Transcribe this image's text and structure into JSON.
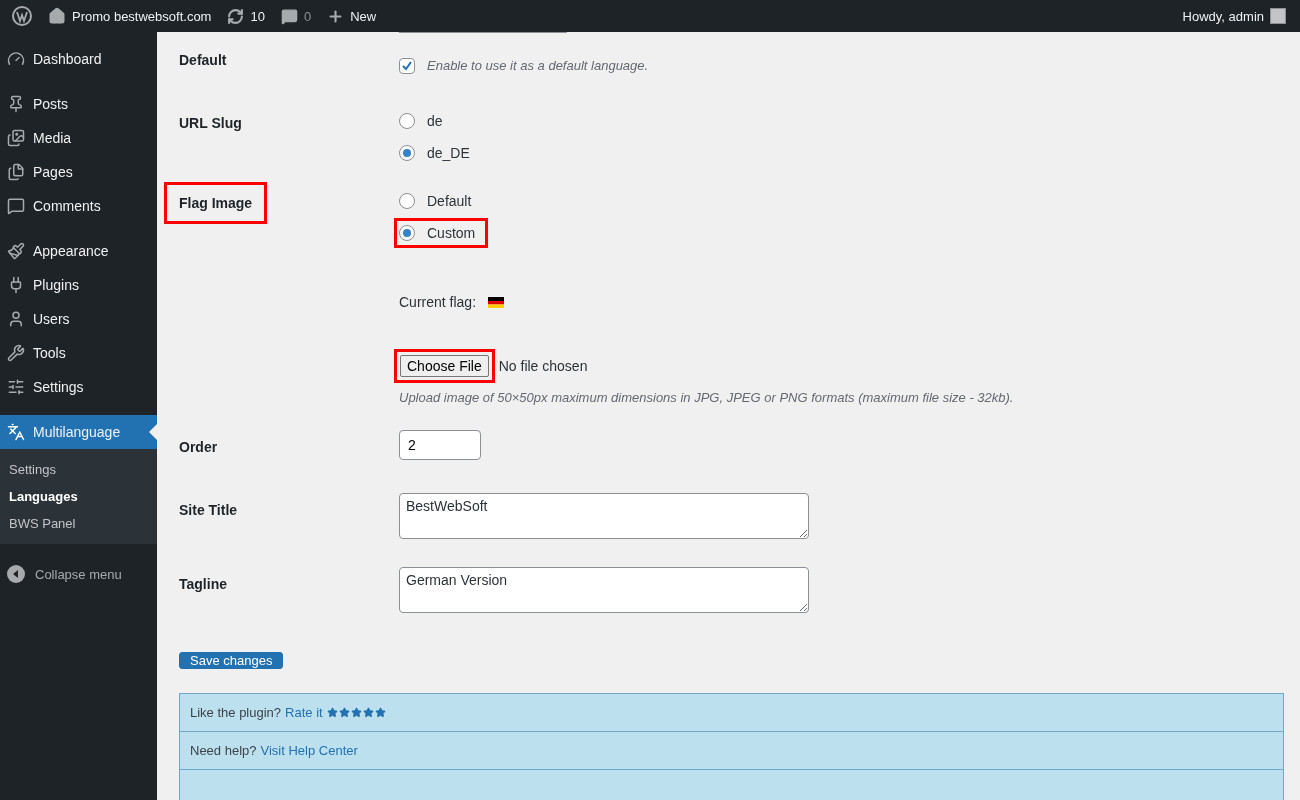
{
  "admin_bar": {
    "site": "Promo bestwebsoft.com",
    "updates": "10",
    "comments": "0",
    "new": "New",
    "greeting": "Howdy, admin"
  },
  "sidebar": {
    "groups": [
      [
        {
          "label": "Dashboard",
          "current": false
        }
      ],
      [
        {
          "label": "Posts",
          "current": false
        },
        {
          "label": "Media",
          "current": false
        },
        {
          "label": "Pages",
          "current": false
        },
        {
          "label": "Comments",
          "current": false
        }
      ],
      [
        {
          "label": "Appearance",
          "current": false
        },
        {
          "label": "Plugins",
          "current": false
        },
        {
          "label": "Users",
          "current": false
        },
        {
          "label": "Tools",
          "current": false
        },
        {
          "label": "Settings",
          "current": false
        }
      ],
      [
        {
          "label": "Multilanguage",
          "current": true,
          "children": [
            {
              "label": "Settings",
              "selected": false
            },
            {
              "label": "Languages",
              "selected": true
            },
            {
              "label": "BWS Panel",
              "selected": false
            }
          ]
        }
      ]
    ],
    "collapse": "Collapse menu"
  },
  "form": {
    "fields": [
      {
        "kind": "checkbox",
        "label": "Default",
        "checked": true,
        "text": "Enable to use it as a default language."
      },
      {
        "kind": "radio",
        "label": "URL Slug",
        "options": [
          {
            "label": "de",
            "selected": false
          },
          {
            "label": "de_DE",
            "selected": true
          }
        ]
      },
      {
        "kind": "flag",
        "label": "Flag Image",
        "highlighted": true,
        "options": [
          {
            "label": "Default",
            "selected": false,
            "highlighted": false
          },
          {
            "label": "Custom",
            "selected": true,
            "highlighted": true
          }
        ],
        "current_flag": "Current flag:",
        "file_button": "Choose File",
        "file_button_highlighted": true,
        "file_status": "No file chosen",
        "hint": "Upload image of 50×50px maximum dimensions in JPG, JPEG or PNG formats (maximum file size - 32kb)."
      },
      {
        "kind": "input",
        "label": "Order",
        "value": "2"
      },
      {
        "kind": "textarea",
        "label": "Site Title",
        "value": "BestWebSoft"
      },
      {
        "kind": "textarea",
        "label": "Tagline",
        "value": "German Version"
      }
    ]
  },
  "save_button": "Save changes",
  "notice": {
    "rows": [
      {
        "text": "Like the plugin?",
        "link": "Rate it",
        "stars": 5
      },
      {
        "text": "Need help?",
        "link": "Visit Help Center"
      }
    ]
  }
}
